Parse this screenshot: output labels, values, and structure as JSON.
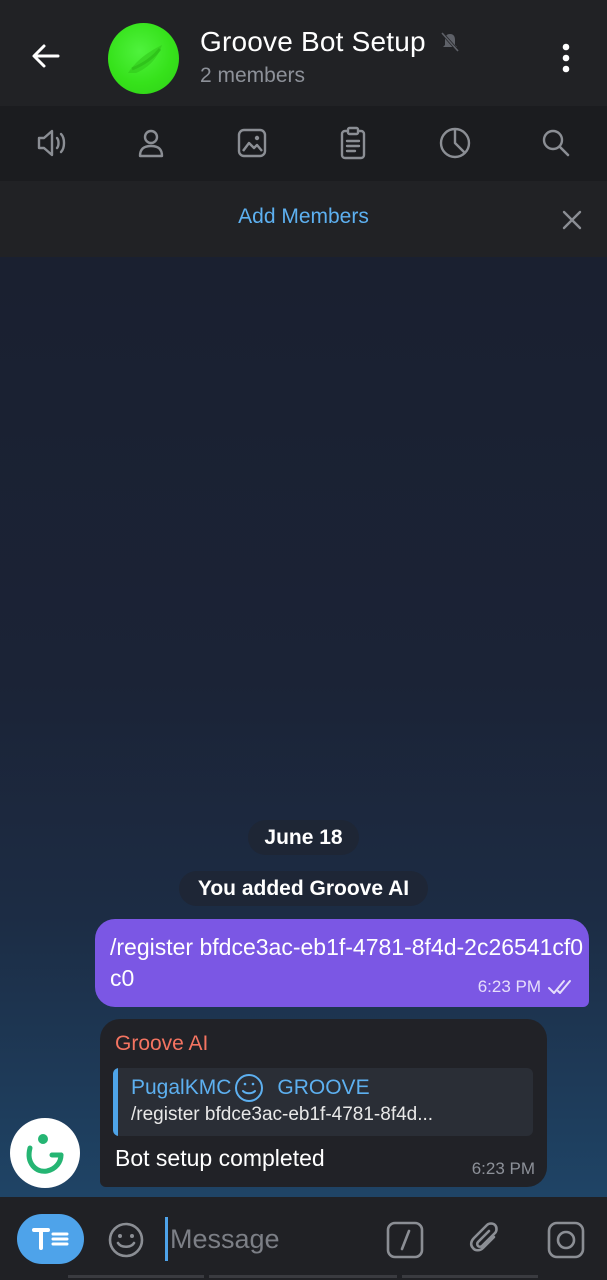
{
  "header": {
    "title": "Groove Bot Setup",
    "subtitle": "2 members"
  },
  "add_members": {
    "label": "Add Members"
  },
  "chat": {
    "date": "June 18",
    "service_message": "You added Groove AI",
    "outgoing": {
      "text": "/register bfdce3ac-eb1f-4781-8f4d-2c26541cf0c0",
      "time": "6:23 PM"
    },
    "incoming": {
      "sender": "Groove AI",
      "reply_name": "PugalKMC",
      "reply_name_suffix": "GROOVE",
      "reply_text": "/register bfdce3ac-eb1f-4781-8f4d...",
      "text": "Bot setup completed",
      "time": "6:23 PM"
    }
  },
  "composer": {
    "placeholder": "Message"
  },
  "colors": {
    "accent": "#5db0f0",
    "outgoing_bubble": "#7b57e4",
    "sender_name": "#f47461",
    "avatar_green": "#36e21b"
  },
  "icons": {
    "header": [
      "back-arrow-icon",
      "mute-icon",
      "more-vertical-icon"
    ],
    "actionbar": [
      "speaker-icon",
      "profile-icon",
      "image-icon",
      "clipboard-icon",
      "pie-chart-icon",
      "search-icon"
    ],
    "composer": [
      "bot-menu-icon",
      "emoji-icon",
      "slash-command-icon",
      "attach-icon",
      "camera-icon"
    ]
  }
}
